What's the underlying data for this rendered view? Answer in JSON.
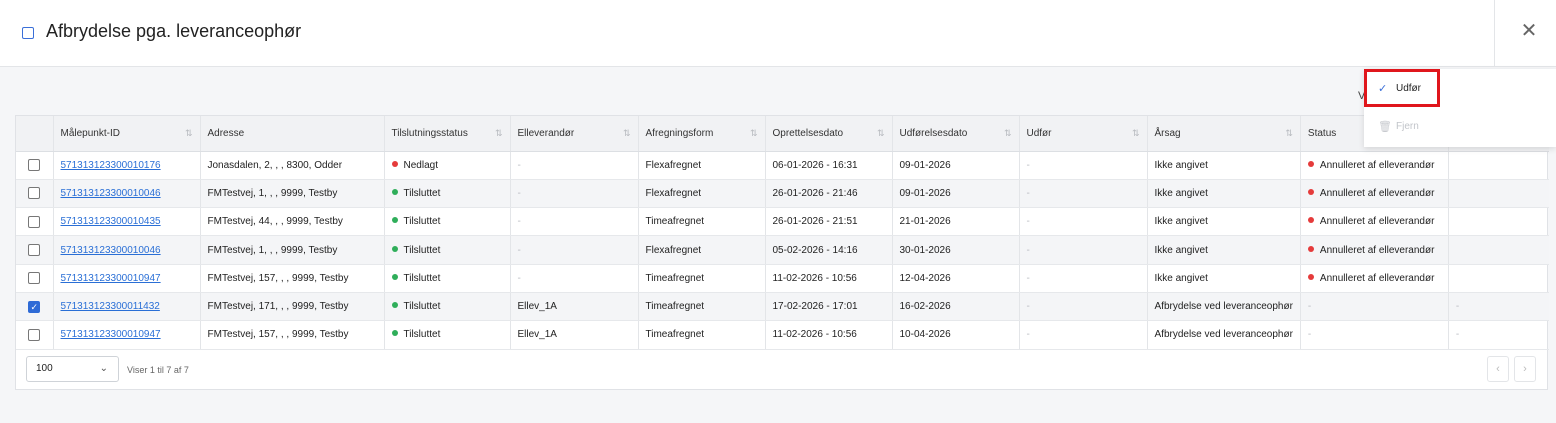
{
  "header": {
    "title": "Afbrydelse pga. leveranceophør",
    "close_icon": "close-icon"
  },
  "menu": {
    "execute_label": "Udfør",
    "remove_label": "Fjern",
    "behind_text": "V"
  },
  "table": {
    "columns": [
      "Målepunkt-ID",
      "Adresse",
      "Tilslutningsstatus",
      "Elleverandør",
      "Afregningsform",
      "Oprettelsesdato",
      "Udførelsesdato",
      "Udfør",
      "Årsag",
      "Status"
    ],
    "rows": [
      {
        "checked": false,
        "id": "571313123300010176",
        "address": "Jonasdalen, 2, , , 8300, Odder",
        "conn": "Nedlagt",
        "conn_color": "red",
        "supplier": "-",
        "settle": "Flexafregnet",
        "created": "06-01-2026 - 16:31",
        "exec_date": "09-01-2026",
        "udfor": "-",
        "reason": "Ikke angivet",
        "status": "Annulleret af elleverandør",
        "status_color": "red",
        "extra": ""
      },
      {
        "checked": false,
        "id": "571313123300010046",
        "address": "FMTestvej, 1, , , 9999, Testby",
        "conn": "Tilsluttet",
        "conn_color": "green",
        "supplier": "-",
        "settle": "Flexafregnet",
        "created": "26-01-2026 - 21:46",
        "exec_date": "09-01-2026",
        "udfor": "-",
        "reason": "Ikke angivet",
        "status": "Annulleret af elleverandør",
        "status_color": "red",
        "extra": ""
      },
      {
        "checked": false,
        "id": "571313123300010435",
        "address": "FMTestvej, 44, , , 9999, Testby",
        "conn": "Tilsluttet",
        "conn_color": "green",
        "supplier": "-",
        "settle": "Timeafregnet",
        "created": "26-01-2026 - 21:51",
        "exec_date": "21-01-2026",
        "udfor": "-",
        "reason": "Ikke angivet",
        "status": "Annulleret af elleverandør",
        "status_color": "red",
        "extra": ""
      },
      {
        "checked": false,
        "id": "571313123300010046",
        "address": "FMTestvej, 1, , , 9999, Testby",
        "conn": "Tilsluttet",
        "conn_color": "green",
        "supplier": "-",
        "settle": "Flexafregnet",
        "created": "05-02-2026 - 14:16",
        "exec_date": "30-01-2026",
        "udfor": "-",
        "reason": "Ikke angivet",
        "status": "Annulleret af elleverandør",
        "status_color": "red",
        "extra": ""
      },
      {
        "checked": false,
        "id": "571313123300010947",
        "address": "FMTestvej, 157, , , 9999, Testby",
        "conn": "Tilsluttet",
        "conn_color": "green",
        "supplier": "-",
        "settle": "Timeafregnet",
        "created": "11-02-2026 - 10:56",
        "exec_date": "12-04-2026",
        "udfor": "-",
        "reason": "Ikke angivet",
        "status": "Annulleret af elleverandør",
        "status_color": "red",
        "extra": ""
      },
      {
        "checked": true,
        "id": "571313123300011432",
        "address": "FMTestvej, 171, , , 9999, Testby",
        "conn": "Tilsluttet",
        "conn_color": "green",
        "supplier": "Ellev_1A",
        "settle": "Timeafregnet",
        "created": "17-02-2026 - 17:01",
        "exec_date": "16-02-2026",
        "udfor": "-",
        "reason": "Afbrydelse ved leveranceophør",
        "status": "-",
        "status_color": "",
        "extra": "-"
      },
      {
        "checked": false,
        "id": "571313123300010947",
        "address": "FMTestvej, 157, , , 9999, Testby",
        "conn": "Tilsluttet",
        "conn_color": "green",
        "supplier": "Ellev_1A",
        "settle": "Timeafregnet",
        "created": "11-02-2026 - 10:56",
        "exec_date": "10-04-2026",
        "udfor": "-",
        "reason": "Afbrydelse ved leveranceophør",
        "status": "-",
        "status_color": "",
        "extra": "-"
      }
    ]
  },
  "footer": {
    "page_size": "100",
    "info": "Viser 1 til 7 af 7"
  }
}
